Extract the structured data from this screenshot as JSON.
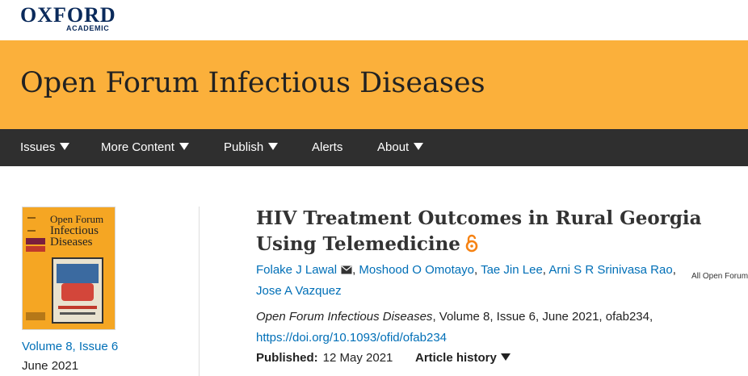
{
  "brand": {
    "name": "OXFORD",
    "sub": "ACADEMIC"
  },
  "journal": {
    "title": "Open Forum Infectious Diseases"
  },
  "nav": {
    "items": [
      {
        "label": "Issues"
      },
      {
        "label": "More Content"
      },
      {
        "label": "Publish"
      },
      {
        "label": "Alerts"
      },
      {
        "label": "About"
      }
    ],
    "search_scope": "All Open Forum Infectious Diseases"
  },
  "cover": {
    "line1": "Open Forum",
    "line2": "Infectious",
    "line3": "Diseases"
  },
  "issue": {
    "link": "Volume 8, Issue 6",
    "date": "June 2021"
  },
  "article": {
    "title": "HIV Treatment Outcomes in Rural Georgia Using Telemedicine",
    "authors": [
      "Folake J Lawal",
      "Moshood O Omotayo",
      "Tae Jin Lee",
      "Arni S R Srinivasa Rao",
      "Jose A Vazquez"
    ],
    "citation_journal": "Open Forum Infectious Diseases",
    "citation_rest": ", Volume 8, Issue 6, June 2021, ofab234,",
    "doi": "https://doi.org/10.1093/ofid/ofab234",
    "published_label": "Published:",
    "published_date": "12 May 2021",
    "history_label": "Article history"
  },
  "colors": {
    "banner": "#fbb03b",
    "nav": "#2f2f2f",
    "link": "#006fb7",
    "brand": "#0a2a5b",
    "open_access": "#f68212"
  }
}
